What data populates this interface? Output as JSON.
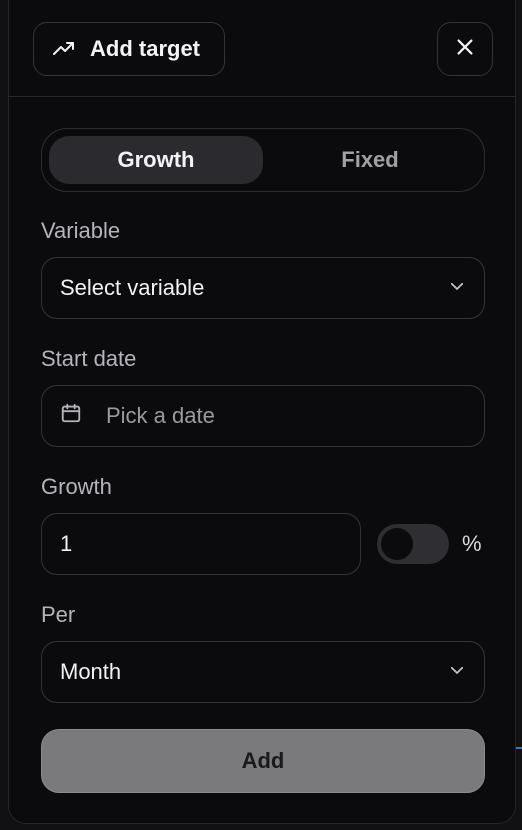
{
  "header": {
    "title": "Add target",
    "title_icon": "trending-up-icon",
    "close_icon": "close-icon"
  },
  "mode_tabs": [
    {
      "label": "Growth",
      "active": true
    },
    {
      "label": "Fixed",
      "active": false
    }
  ],
  "variable": {
    "label": "Variable",
    "value": "Select variable",
    "icon": "chevron-down-icon"
  },
  "start_date": {
    "label": "Start date",
    "placeholder": "Pick a date",
    "icon": "calendar-icon"
  },
  "growth": {
    "label": "Growth",
    "value": "1",
    "percent_toggle_on": false,
    "percent_label": "%"
  },
  "per": {
    "label": "Per",
    "value": "Month",
    "icon": "chevron-down-icon"
  },
  "actions": {
    "add_label": "Add"
  },
  "colors": {
    "background": "#0b0b0d",
    "border": "#33333a",
    "active_segment": "#2a2a2f",
    "add_button": "#7a7a7d"
  }
}
